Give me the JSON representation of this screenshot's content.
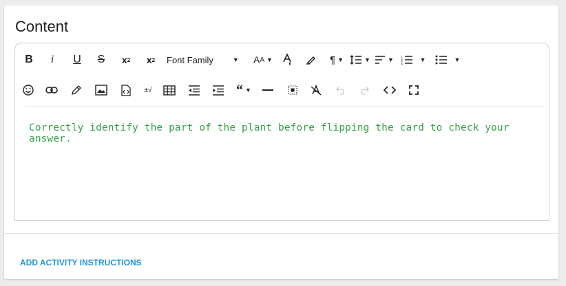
{
  "card": {
    "title": "Content"
  },
  "toolbar": {
    "font_family_label": "Font Family",
    "row1": [
      "bold-icon",
      "italic-icon",
      "underline-icon",
      "strikethrough-icon",
      "subscript-icon",
      "superscript-icon",
      "font-family-select",
      "font-size-icon",
      "text-color-icon",
      "highlight-icon",
      "paragraph-icon",
      "line-height-icon",
      "align-icon",
      "ordered-list-icon",
      "unordered-list-icon"
    ],
    "row2": [
      "emoji-icon",
      "link-icon",
      "pencil-icon",
      "image-icon",
      "file-code-icon",
      "special-chars-icon",
      "table-icon",
      "outdent-icon",
      "indent-icon",
      "quote-icon",
      "horizontal-rule-icon",
      "select-all-icon",
      "clear-formatting-icon",
      "undo-icon",
      "redo-icon",
      "code-view-icon",
      "fullscreen-icon"
    ]
  },
  "editor": {
    "content": "Correctly identify the part of the plant before flipping the card to check your answer.",
    "content_color": "#3aa04a"
  },
  "footer": {
    "add_instructions_label": "ADD ACTIVITY INSTRUCTIONS",
    "link_color": "#2196d8"
  }
}
